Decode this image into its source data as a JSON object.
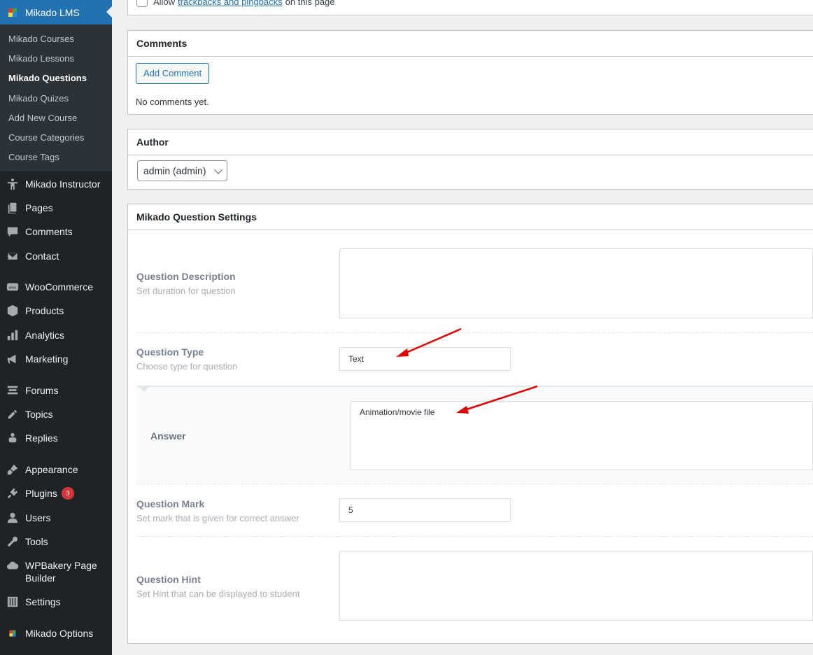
{
  "sidebar": {
    "header": {
      "label": "Mikado LMS",
      "icon": "mikado-logo-icon"
    },
    "submenu": [
      {
        "label": "Mikado Courses"
      },
      {
        "label": "Mikado Lessons"
      },
      {
        "label": "Mikado Questions",
        "current": true
      },
      {
        "label": "Mikado Quizes"
      },
      {
        "label": "Add New Course"
      },
      {
        "label": "Course Categories"
      },
      {
        "label": "Course Tags"
      }
    ],
    "items": {
      "instructor": "Mikado Instructor",
      "pages": "Pages",
      "comments": "Comments",
      "contact": "Contact",
      "woocommerce": "WooCommerce",
      "products": "Products",
      "analytics": "Analytics",
      "marketing": "Marketing",
      "forums": "Forums",
      "topics": "Topics",
      "replies": "Replies",
      "appearance": "Appearance",
      "plugins": "Plugins",
      "plugins_badge": "3",
      "users": "Users",
      "tools": "Tools",
      "wpbakery_line1": "WPBakery Page",
      "wpbakery_line2": "Builder",
      "settings": "Settings",
      "mikado_options": "Mikado Options"
    }
  },
  "discussion": {
    "allow_text": "Allow",
    "link_text": "trackbacks and pingbacks",
    "suffix_text": "on this page"
  },
  "comments_box": {
    "title": "Comments",
    "add_button": "Add Comment",
    "empty_text": "No comments yet."
  },
  "author_box": {
    "title": "Author",
    "selected": "admin (admin)"
  },
  "question_settings": {
    "title": "Mikado Question Settings",
    "description": {
      "label": "Question Description",
      "help": "Set duration for question",
      "value": ""
    },
    "type": {
      "label": "Question Type",
      "help": "Choose type for question",
      "value": "Text"
    },
    "answer": {
      "label": "Answer",
      "value": "Animation/movie file"
    },
    "mark": {
      "label": "Question Mark",
      "help": "Set mark that is given for correct answer",
      "value": "5"
    },
    "hint": {
      "label": "Question Hint",
      "help": "Set Hint that can be displayed to student",
      "value": ""
    }
  },
  "colors": {
    "sidebar_bg": "#1d2327",
    "submenu_bg": "#2c3338",
    "accent": "#2271b1",
    "badge": "#d63638",
    "annotation_arrow": "#e00000"
  }
}
